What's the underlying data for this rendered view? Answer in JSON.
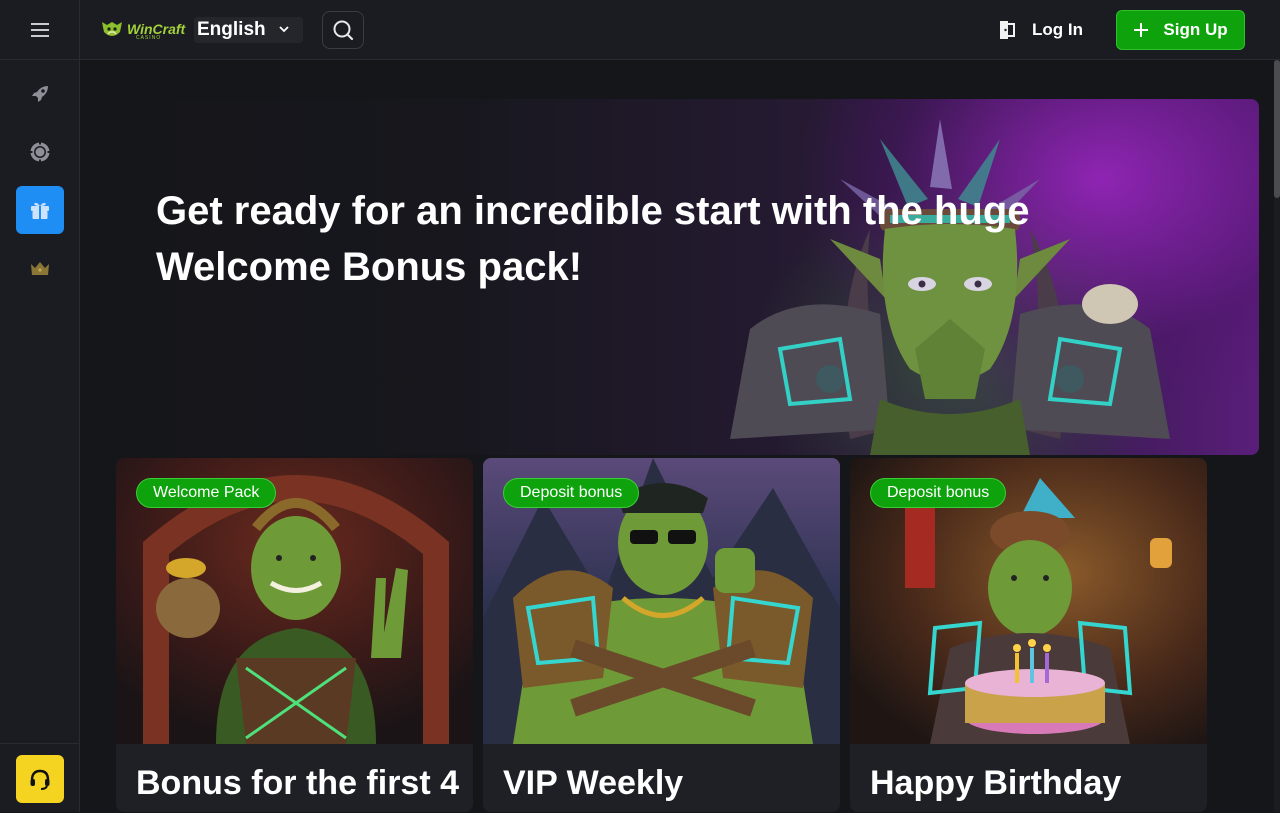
{
  "header": {
    "logo_text": "WinCraft",
    "logo_subtext": "CASINO",
    "language": "English",
    "login_label": "Log In",
    "signup_label": "Sign Up"
  },
  "sidebar": {
    "items": [
      {
        "name": "rocket-icon",
        "active": false
      },
      {
        "name": "casino-chip-icon",
        "active": false
      },
      {
        "name": "gift-icon",
        "active": true
      },
      {
        "name": "crown-icon",
        "active": false
      }
    ],
    "support_icon": "headset-icon"
  },
  "hero": {
    "title_line1": "Get ready for an incredible start with the huge",
    "title_line2": "Welcome Bonus pack!"
  },
  "cards": [
    {
      "badge": "Welcome Pack",
      "title": "Bonus for the first 4"
    },
    {
      "badge": "Deposit bonus",
      "title": "VIP Weekly"
    },
    {
      "badge": "Deposit bonus",
      "title": "Happy Birthday"
    }
  ],
  "colors": {
    "accent_green": "#0ea30c",
    "active_blue": "#1e8ef5",
    "support_yellow": "#f4d420",
    "logo_green": "#a3d13c"
  }
}
